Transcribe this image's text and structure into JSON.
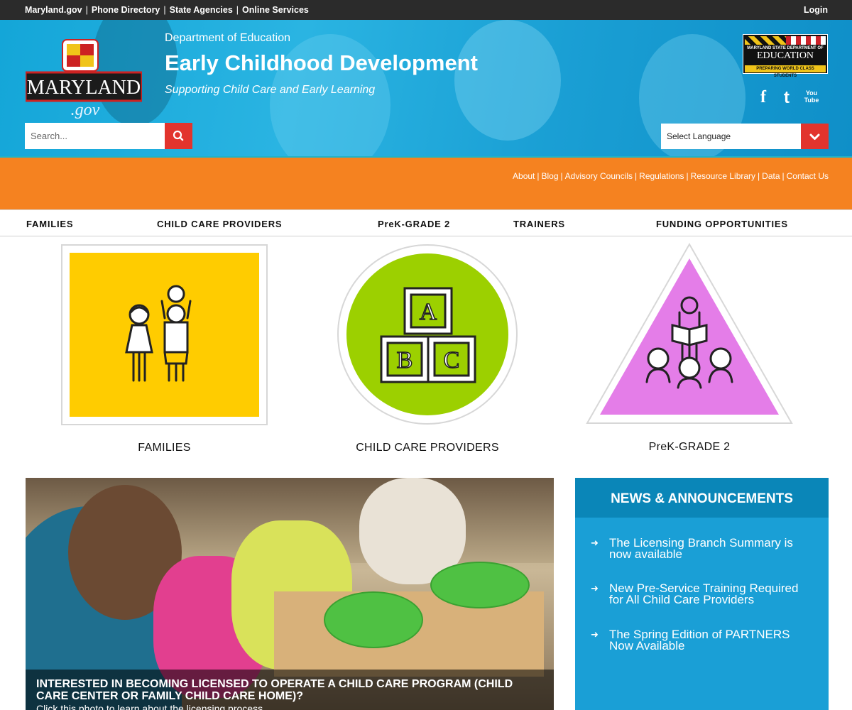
{
  "utility": {
    "links": [
      "Maryland.gov",
      "Phone Directory",
      "State Agencies",
      "Online Services"
    ],
    "login": "Login"
  },
  "header": {
    "department": "Department of Education",
    "title": "Early Childhood Development",
    "tagline": "Supporting Child Care and Early Learning",
    "maryland_logo": {
      "word": "MARYLAND",
      "suffix": ".gov"
    },
    "msde_logo": {
      "line1": "MARYLAND STATE DEPARTMENT OF",
      "line2": "EDUCATION",
      "line3": "PREPARING WORLD CLASS STUDENTS"
    },
    "social": [
      {
        "name": "facebook-icon",
        "glyph": "f"
      },
      {
        "name": "twitter-icon",
        "glyph": "t"
      },
      {
        "name": "youtube-icon",
        "glyph": "You Tube"
      }
    ],
    "search": {
      "placeholder": "Search..."
    },
    "language": {
      "selected": "Select Language"
    }
  },
  "orange_bar": {
    "links": [
      "About",
      "Blog",
      "Advisory Councils",
      "Regulations",
      "Resource Library",
      "Data",
      "Contact Us"
    ]
  },
  "nav": {
    "items": [
      "FAMILIES",
      "CHILD CARE PROVIDERS",
      "PreK-GRADE 2",
      "TRAINERS",
      "FUNDING OPPORTUNITIES"
    ]
  },
  "tiles": [
    {
      "label": "FAMILIES",
      "color": "#ffcc00"
    },
    {
      "label": "CHILD CARE PROVIDERS",
      "color": "#9cd000",
      "blocks": [
        "A",
        "B",
        "C"
      ]
    },
    {
      "label": "PreK-GRADE 2",
      "color": "#e47de8"
    }
  ],
  "feature": {
    "caption_title": "Interested in becoming licensed to operate a child care program (Child Care Center or Family Child Care Home)?",
    "caption_sub": "Click this photo to learn about the licensing process."
  },
  "news": {
    "heading": "NEWS & ANNOUNCEMENTS",
    "items": [
      "The Licensing Branch Summary is now available",
      "New Pre-Service Training Required for All Child Care Providers",
      "The Spring Edition of PARTNERS Now Available"
    ]
  },
  "colors": {
    "accent_red": "#e2342d",
    "orange": "#f58220",
    "blue": "#1a9fd6",
    "dark": "#2b2b2b"
  }
}
